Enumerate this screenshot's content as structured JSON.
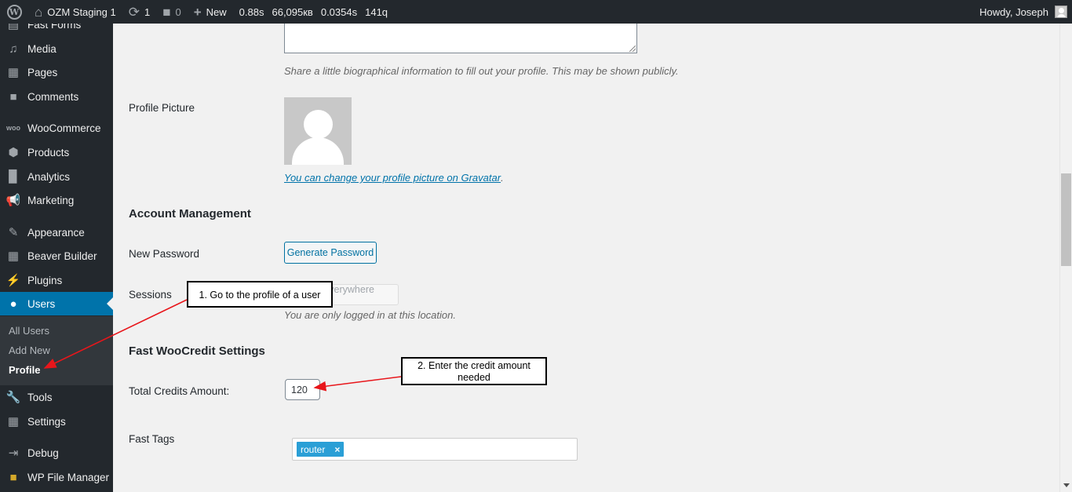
{
  "adminbar": {
    "site_name": "OZM Staging 1",
    "updates_count": "1",
    "comments_count": "0",
    "new_label": "New",
    "stat_time": "0.88s",
    "stat_memory": "66,095кв",
    "stat_query_time": "0.0354s",
    "stat_queries": "141q",
    "howdy": "Howdy, Joseph"
  },
  "sidebar": {
    "items": [
      {
        "label": "Fast Forms",
        "icon": "forms-icon"
      },
      {
        "label": "Media",
        "icon": "media-icon"
      },
      {
        "label": "Pages",
        "icon": "pages-icon"
      },
      {
        "label": "Comments",
        "icon": "comments-icon"
      },
      {
        "label": "WooCommerce",
        "icon": "woocommerce-icon"
      },
      {
        "label": "Products",
        "icon": "products-icon"
      },
      {
        "label": "Analytics",
        "icon": "analytics-icon"
      },
      {
        "label": "Marketing",
        "icon": "marketing-icon"
      },
      {
        "label": "Appearance",
        "icon": "appearance-icon"
      },
      {
        "label": "Beaver Builder",
        "icon": "beaver-builder-icon"
      },
      {
        "label": "Plugins",
        "icon": "plugins-icon"
      },
      {
        "label": "Users",
        "icon": "users-icon"
      },
      {
        "label": "Tools",
        "icon": "tools-icon"
      },
      {
        "label": "Settings",
        "icon": "settings-icon"
      },
      {
        "label": "Debug",
        "icon": "debug-icon"
      },
      {
        "label": "WP File Manager",
        "icon": "folder-icon"
      }
    ],
    "users_submenu": [
      "All Users",
      "Add New",
      "Profile"
    ]
  },
  "profile": {
    "bio_description": "Share a little biographical information to fill out your profile. This may be shown publicly.",
    "picture_label": "Profile Picture",
    "gravatar_link": "You can change your profile picture on Gravatar",
    "gravatar_period": ".",
    "account_heading": "Account Management",
    "new_password_label": "New Password",
    "generate_password_button": "Generate Password",
    "sessions_label": "Sessions",
    "logout_everywhere_button": "Log Out Everywhere Else",
    "sessions_description": "You are only logged in at this location.",
    "woocredit_heading": "Fast WooCredit Settings",
    "total_credits_label": "Total Credits Amount:",
    "total_credits_value": "120",
    "fast_tags_label": "Fast Tags",
    "tags": [
      "router"
    ],
    "tag_remove": "×"
  },
  "callouts": {
    "step1": "1. Go to the profile of a user",
    "step2": "2. Enter the credit amount needed"
  },
  "colors": {
    "adminbar_bg": "#23282d",
    "menu_active": "#0073aa",
    "link": "#0073aa",
    "tag_bg": "#2a9fd6",
    "arrow": "#e8161b"
  }
}
